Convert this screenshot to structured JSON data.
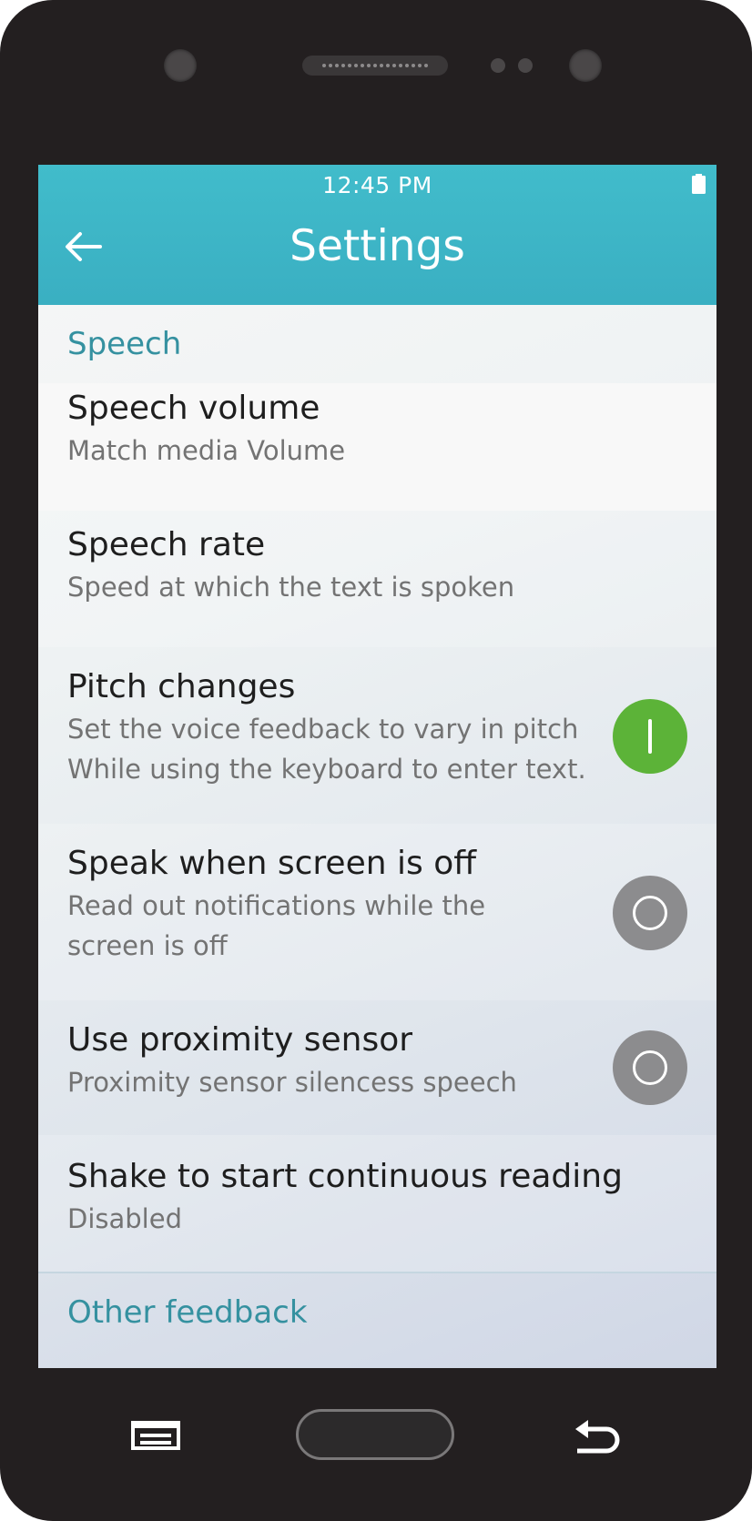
{
  "status_bar": {
    "time": "12:45 PM",
    "battery_icon": "battery-full-icon"
  },
  "app_bar": {
    "title": "Settings",
    "back_icon": "arrow-left-icon"
  },
  "sections": [
    {
      "header": "Speech",
      "items": [
        {
          "title": "Speech volume",
          "subtitle": "Match media Volume"
        },
        {
          "title": "Speech rate",
          "subtitle": "Speed at which the text is spoken"
        },
        {
          "title": "Pitch changes",
          "subtitle_lines": [
            "Set the voice feedback to vary in pitch",
            "While using the keyboard to enter text."
          ],
          "toggle": "on"
        },
        {
          "title": "Speak when screen is off",
          "subtitle_lines": [
            "Read out notifications while the",
            "screen is off"
          ],
          "toggle": "off"
        },
        {
          "title": "Use proximity sensor",
          "subtitle": "Proximity sensor silencess speech",
          "toggle": "off"
        },
        {
          "title": "Shake to start continuous reading",
          "subtitle": "Disabled"
        }
      ]
    },
    {
      "header": "Other feedback",
      "items": []
    }
  ],
  "nav_bar": {
    "menu_icon": "menu-icon",
    "home_icon": "home-button",
    "back_icon": "back-arrow-icon"
  },
  "colors": {
    "accent": "#41bccb",
    "section_header": "#3591a0",
    "toggle_on": "#5cb338",
    "toggle_off": "#8c8c8e",
    "device_body": "#231f20"
  }
}
